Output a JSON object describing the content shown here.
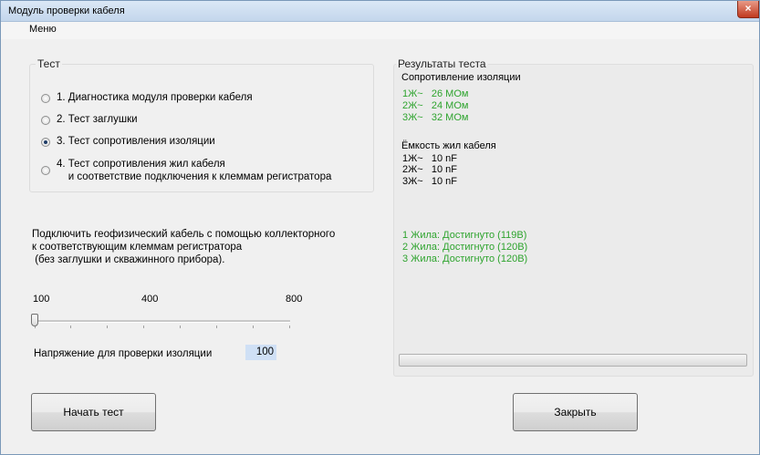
{
  "window": {
    "title": "Модуль проверки кабеля",
    "close_glyph": "×"
  },
  "menu": {
    "label": "Меню"
  },
  "test_group": {
    "legend": "Тест",
    "options": [
      {
        "label": "1. Диагностика модуля проверки кабеля",
        "checked": false
      },
      {
        "label": "2. Тест заглушки",
        "checked": false
      },
      {
        "label": "3. Тест сопротивления изоляции",
        "checked": true
      },
      {
        "label": "4. Тест сопротивления жил кабеля\n    и соответствие подключения к клеммам регистратора",
        "checked": false
      }
    ]
  },
  "instruction": "Подключить геофизический кабель с помощью коллекторного\nк соответствующим клеммам регистратора\n (без заглушки и скважинного прибора).",
  "slider": {
    "min_label": "100",
    "mid_label": "400",
    "max_label": "800",
    "value": 100
  },
  "voltage": {
    "label": "Напряжение для проверки изоляции",
    "value": "100"
  },
  "results": {
    "legend": "Результаты теста",
    "insulation_title": "Сопротивление изоляции",
    "insulation_lines": [
      "1Ж~   26 МОм",
      "2Ж~   24 МОм",
      "3Ж~   32 МОм"
    ],
    "capacity_title": "Ёмкость жил кабеля",
    "capacity_lines": [
      "1Ж~   10 nF",
      "2Ж~   10 nF",
      "3Ж~   10 nF"
    ],
    "reached_lines": [
      "1 Жила: Достигнуто (119В)",
      "2 Жила: Достигнуто (120В)",
      "3 Жила: Достигнуто (120В)"
    ],
    "progress": 0
  },
  "buttons": {
    "start": "Начать тест",
    "close": "Закрыть"
  },
  "colors": {
    "accent_green": "#2ea42e",
    "input_highlight": "#cfe0f5",
    "close_red": "#c0391f"
  }
}
